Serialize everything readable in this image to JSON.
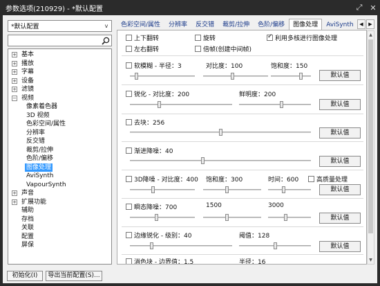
{
  "window": {
    "title": "参数选项(210929) - *默认配置",
    "btn_pin": "⤢",
    "btn_close": "✕"
  },
  "sidebar": {
    "profile": "*默认配置",
    "search_placeholder": "",
    "tree": [
      {
        "label": "基本",
        "exp": "+",
        "child": false,
        "selected": false
      },
      {
        "label": "播放",
        "exp": "+",
        "child": false,
        "selected": false
      },
      {
        "label": "字幕",
        "exp": "+",
        "child": false,
        "selected": false
      },
      {
        "label": "设备",
        "exp": "+",
        "child": false,
        "selected": false
      },
      {
        "label": "滤镜",
        "exp": "+",
        "child": false,
        "selected": false
      },
      {
        "label": "视频",
        "exp": "−",
        "child": false,
        "selected": false
      },
      {
        "label": "像素着色器",
        "exp": "",
        "child": true,
        "selected": false
      },
      {
        "label": "3D 视频",
        "exp": "",
        "child": true,
        "selected": false
      },
      {
        "label": "色彩空间/属性",
        "exp": "",
        "child": true,
        "selected": false
      },
      {
        "label": "分辨率",
        "exp": "",
        "child": true,
        "selected": false
      },
      {
        "label": "反交错",
        "exp": "",
        "child": true,
        "selected": false
      },
      {
        "label": "裁剪/拉伸",
        "exp": "",
        "child": true,
        "selected": false
      },
      {
        "label": "色阶/偏移",
        "exp": "",
        "child": true,
        "selected": false
      },
      {
        "label": "图像处理",
        "exp": "",
        "child": true,
        "selected": true
      },
      {
        "label": "AviSynth",
        "exp": "",
        "child": true,
        "selected": false
      },
      {
        "label": "VapourSynth",
        "exp": "",
        "child": true,
        "selected": false
      },
      {
        "label": "声音",
        "exp": "+",
        "child": false,
        "selected": false
      },
      {
        "label": "扩展功能",
        "exp": "+",
        "child": false,
        "selected": false
      },
      {
        "label": "辅助",
        "exp": "",
        "child": false,
        "selected": false
      },
      {
        "label": "存档",
        "exp": "",
        "child": false,
        "selected": false
      },
      {
        "label": "关联",
        "exp": "",
        "child": false,
        "selected": false
      },
      {
        "label": "配置",
        "exp": "",
        "child": false,
        "selected": false
      },
      {
        "label": "屏保",
        "exp": "",
        "child": false,
        "selected": false
      }
    ]
  },
  "tabs": [
    "色彩空间/属性",
    "分辨率",
    "反交错",
    "裁剪/拉伸",
    "色阶/偏移",
    "图像处理",
    "AviSynth"
  ],
  "active_tab": 5,
  "options": {
    "flip_v": "上下翻转",
    "rotate": "旋转",
    "multicore": "利用多核进行图像处理",
    "flip_h": "左右翻转",
    "double_frame": "倍帧(创建中间帧)"
  },
  "sections": {
    "soft_blur": {
      "label": "软模糊 - 半径：3",
      "contrast": "对比度：100",
      "saturation": "饱和度：150",
      "sliders": [
        0.08,
        0.45,
        0.78
      ]
    },
    "sharpen": {
      "label": "锐化 - 对比度：200",
      "brightness": "鲜明度：200",
      "sliders": [
        0.28,
        0.6
      ]
    },
    "deblock": {
      "label": "去块：256",
      "sliders": [
        0.5
      ]
    },
    "denoise": {
      "label": "渐进降噪：40",
      "sliders": [
        0.4
      ]
    },
    "denoise3d": {
      "label": "3D降噪 - 对比度：400",
      "saturation": "饱和度：300",
      "time": "时间：600",
      "hq": "高质量处理",
      "sliders": [
        0.35,
        0.4,
        0.35
      ]
    },
    "temporal": {
      "label": "瞬态降噪：700",
      "v2": "1500",
      "v3": "3000",
      "sliders": [
        0.4,
        0.4,
        0.4
      ]
    },
    "edge": {
      "label": "边缘锐化 - 级别：40",
      "threshold": "阈值：128",
      "sliders": [
        0.2,
        0.5
      ]
    },
    "dering": {
      "label": "消色块 - 边界值：1.5",
      "radius": "半径：16"
    }
  },
  "default_btn": "默认值",
  "bottom": {
    "init": "初始化(I)",
    "export": "导出当前配置(S)..."
  }
}
